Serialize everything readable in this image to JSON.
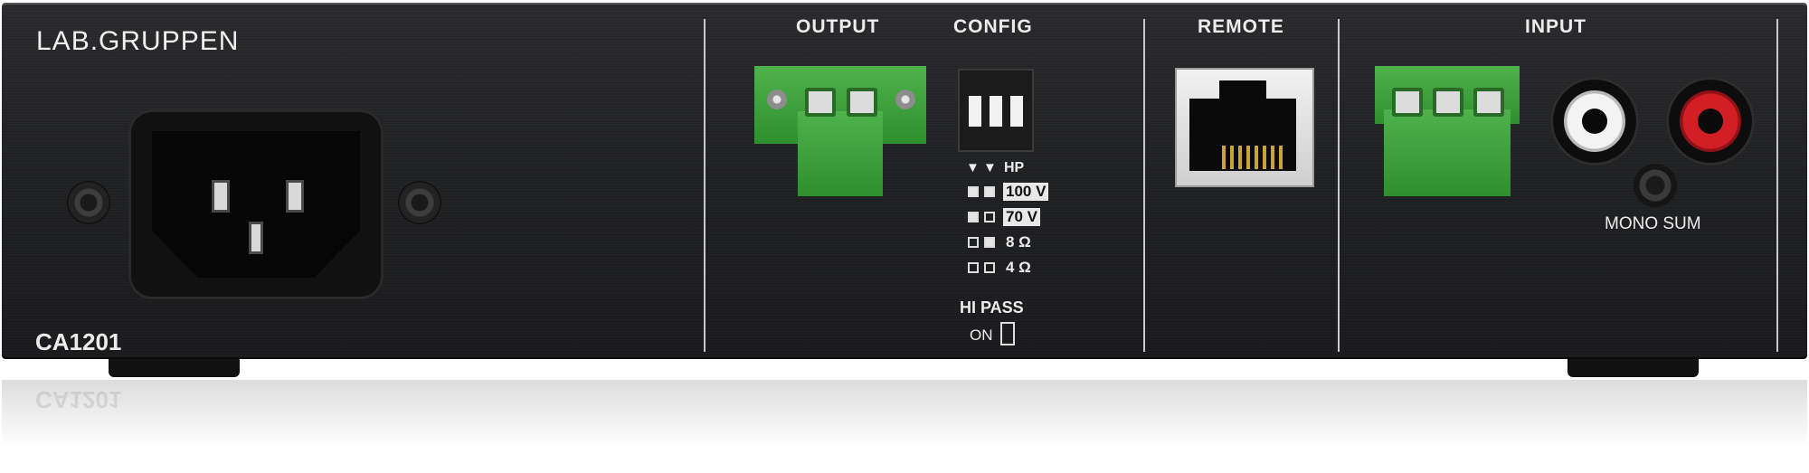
{
  "brand": "LAB.GRUPPEN",
  "model": "CA1201",
  "sections": {
    "output": "OUTPUT",
    "config": "CONFIG",
    "remote": "REMOTE",
    "input": "INPUT"
  },
  "config": {
    "arrow_marks": "▼ ▼",
    "hp_label": "HP",
    "modes": [
      "100 V",
      "70 V",
      "8 Ω",
      "4 Ω"
    ],
    "hi_pass_label": "HI PASS",
    "on_label": "ON"
  },
  "input": {
    "mono_sum_label": "MONO SUM"
  },
  "colors": {
    "chassis": "#1f2022",
    "terminal_green": "#3fa43c",
    "rca_white": "#e9e9e9",
    "rca_red": "#d41e25"
  },
  "icons": [
    "iec-power-inlet-icon",
    "screw-icon",
    "rj45-port-icon",
    "rca-jack-icon",
    "dip-switch-icon"
  ]
}
